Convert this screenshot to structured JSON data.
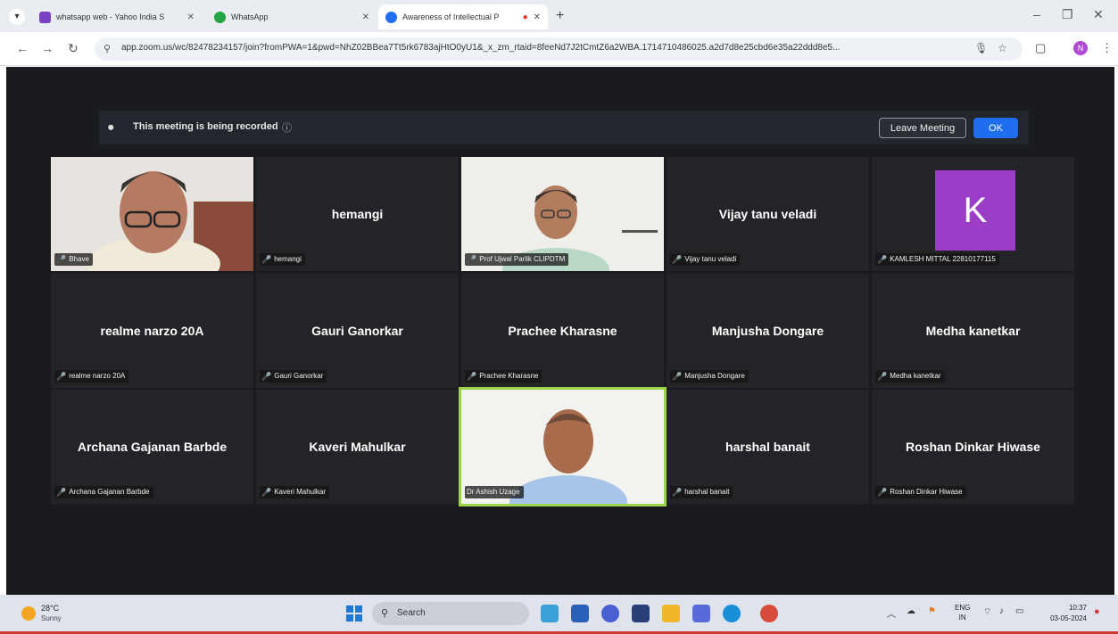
{
  "browser": {
    "tabs": [
      {
        "label": "whatsapp web - Yahoo India S",
        "favicon_color": "#7b3fc4",
        "active": false
      },
      {
        "label": "WhatsApp",
        "favicon_color": "#25a244",
        "active": false
      },
      {
        "label": "Awareness of Intellectual P",
        "favicon_color": "#1f6ef2",
        "active": true
      }
    ],
    "new_tab": "+",
    "url": "app.zoom.us/wc/82478234157/join?fromPWA=1&pwd=NhZ02BBea7Tt5rk6783ajHtO0yU1&_x_zm_rtaid=8feeNd7J2tCmtZ6a2WBA.1714710486025.a2d7d8e25cbd6e35a22ddd8e5...",
    "profile_initial": "N"
  },
  "meeting": {
    "banner": {
      "text": "This meeting is being recorded",
      "leave_label": "Leave Meeting",
      "ok_label": "OK"
    },
    "tiles": [
      {
        "display": "",
        "tag": "Bhave",
        "video": true,
        "speaking": false
      },
      {
        "display": "hemangi",
        "tag": "hemangi",
        "video": false,
        "speaking": false
      },
      {
        "display": "",
        "tag": "Prof Ujwal Parlik CLIPDTM",
        "video": true,
        "speaking": false
      },
      {
        "display": "Vijay tanu veladi",
        "tag": "Vijay tanu veladi",
        "video": false,
        "speaking": false
      },
      {
        "display": "",
        "tag": "KAMLESH MITTAL 22810177115",
        "video": false,
        "speaking": false,
        "avatar": "K"
      },
      {
        "display": "realme narzo 20A",
        "tag": "realme narzo 20A",
        "video": false,
        "speaking": false
      },
      {
        "display": "Gauri Ganorkar",
        "tag": "Gauri Ganorkar",
        "video": false,
        "speaking": false
      },
      {
        "display": "Prachee Kharasne",
        "tag": "Prachee Kharasne",
        "video": false,
        "speaking": false
      },
      {
        "display": "Manjusha Dongare",
        "tag": "Manjusha Dongare",
        "video": false,
        "speaking": false
      },
      {
        "display": "Medha kanetkar",
        "tag": "Medha kanetkar",
        "video": false,
        "speaking": false
      },
      {
        "display": "Archana Gajanan Barbde",
        "tag": "Archana Gajanan Barbde",
        "video": false,
        "speaking": false
      },
      {
        "display": "Kaveri Mahulkar",
        "tag": "Kaveri Mahulkar",
        "video": false,
        "speaking": false
      },
      {
        "display": "",
        "tag": "Dr Ashish Uzage",
        "video": true,
        "speaking": true
      },
      {
        "display": "harshal banait",
        "tag": "harshal banait",
        "video": false,
        "speaking": false
      },
      {
        "display": "Roshan Dinkar Hiwase",
        "tag": "Roshan Dinkar Hiwase",
        "video": false,
        "speaking": false
      }
    ]
  },
  "taskbar": {
    "weather_temp": "28°C",
    "weather_condition": "Sunny",
    "search_label": "Search",
    "lang_line1": "ENG",
    "lang_line2": "IN",
    "time": "10:37",
    "date": "03-05-2024"
  }
}
